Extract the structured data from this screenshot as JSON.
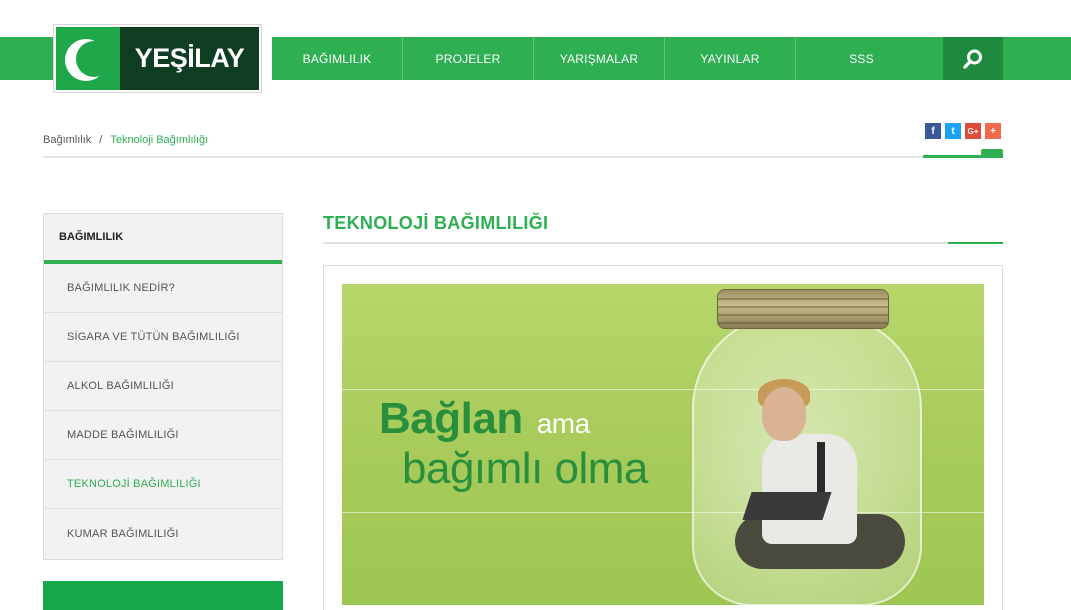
{
  "logo": {
    "text": "YEŞİLAY"
  },
  "nav": {
    "items": [
      "BAĞIMLILIK",
      "PROJELER",
      "YARIŞMALAR",
      "YAYINLAR",
      "SSS"
    ],
    "search_icon": "search-icon"
  },
  "breadcrumb": {
    "root": "Bağımlılık",
    "separator": "/",
    "current": "Teknoloji Bağımlılığı"
  },
  "social": {
    "facebook": "f",
    "twitter": "t",
    "googleplus": "G+",
    "share": "+"
  },
  "sidebar": {
    "heading": "BAĞIMLILIK",
    "items": [
      "BAĞIMLILIK NEDİR?",
      "SİGARA VE TÜTÜN BAĞIMLILIĞI",
      "ALKOL BAĞIMLILIĞI",
      "MADDE BAĞIMLILIĞI",
      "TEKNOLOJİ BAĞIMLILIĞI",
      "KUMAR BAĞIMLILIĞI"
    ],
    "active_index": 4
  },
  "main": {
    "title": "TEKNOLOJİ BAĞIMLILIĞI",
    "banner": {
      "line1_bold": "Bağlan",
      "line1_rest": "ama",
      "line2": "bağımlı olma"
    }
  },
  "colors": {
    "brand_green": "#2eaf52",
    "dark_green": "#0f3d22",
    "banner_green": "#a9cc5d"
  }
}
